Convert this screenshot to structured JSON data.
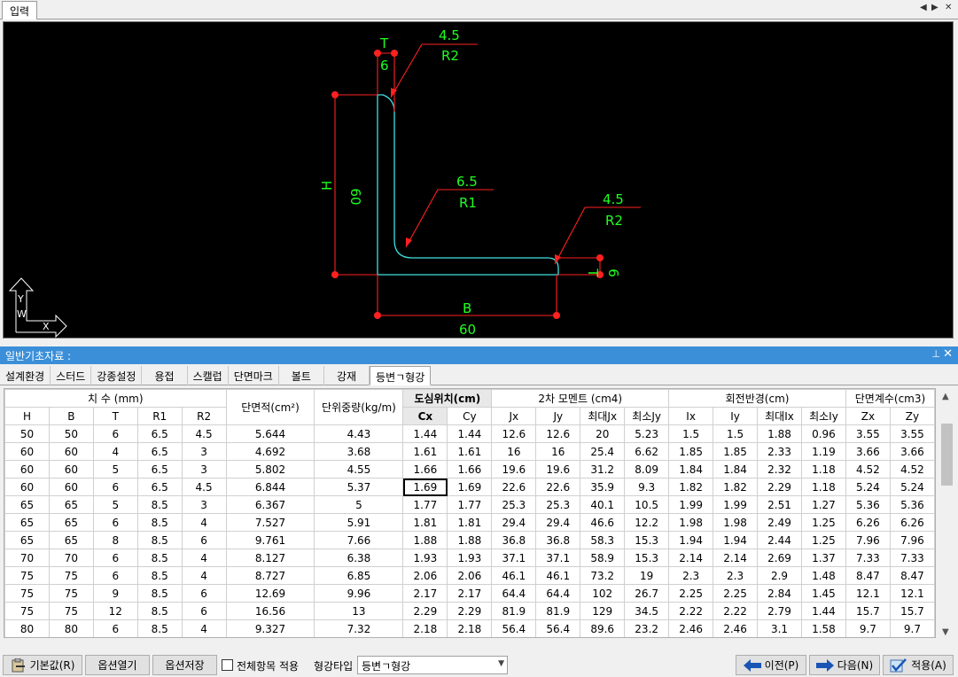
{
  "top_tab": {
    "label": "입력"
  },
  "strip": {
    "prev": "◀",
    "next": "▶",
    "close": "✕"
  },
  "drawing": {
    "t_top_label": "T",
    "t_top_value": "6",
    "r2_top_value": "4.5",
    "r2_top_label": "R2",
    "h_label": "H",
    "h_value": "60",
    "r1_value": "6.5",
    "r1_label": "R1",
    "r2_right_value": "4.5",
    "r2_right_label": "R2",
    "t_right_label": "T",
    "t_right_value": "6",
    "b_label": "B",
    "b_value": "60",
    "axis_y": "Y",
    "axis_w": "W",
    "axis_x": "X"
  },
  "panel": {
    "title": "일반기초자료 :",
    "pin": "⊥",
    "close": "✕"
  },
  "subtabs": [
    "설계환경",
    "스터드",
    "강종설정",
    "용접",
    "스캘럽",
    "단면마크",
    "볼트",
    "강재",
    "등변ㄱ형강"
  ],
  "table": {
    "group_headers": {
      "dims": "치 수 (mm)",
      "area": "단면적(cm²)",
      "weight": "단위중량(kg/m)",
      "centroid": "도심위치(cm)",
      "moment": "2차 모멘트 (cm4)",
      "radius": "회전반경(cm)",
      "modulus": "단면계수(cm3)"
    },
    "sub_headers": [
      "H",
      "B",
      "T",
      "R1",
      "R2",
      "Cx",
      "Cy",
      "Jx",
      "Jy",
      "최대Jx",
      "최소Jy",
      "Ix",
      "Iy",
      "최대Ix",
      "최소Iy",
      "Zx",
      "Zy"
    ],
    "rows": [
      [
        "50",
        "50",
        "6",
        "6.5",
        "4.5",
        "5.644",
        "4.43",
        "1.44",
        "1.44",
        "12.6",
        "12.6",
        "20",
        "5.23",
        "1.5",
        "1.5",
        "1.88",
        "0.96",
        "3.55",
        "3.55"
      ],
      [
        "60",
        "60",
        "4",
        "6.5",
        "3",
        "4.692",
        "3.68",
        "1.61",
        "1.61",
        "16",
        "16",
        "25.4",
        "6.62",
        "1.85",
        "1.85",
        "2.33",
        "1.19",
        "3.66",
        "3.66"
      ],
      [
        "60",
        "60",
        "5",
        "6.5",
        "3",
        "5.802",
        "4.55",
        "1.66",
        "1.66",
        "19.6",
        "19.6",
        "31.2",
        "8.09",
        "1.84",
        "1.84",
        "2.32",
        "1.18",
        "4.52",
        "4.52"
      ],
      [
        "60",
        "60",
        "6",
        "6.5",
        "4.5",
        "6.844",
        "5.37",
        "1.69",
        "1.69",
        "22.6",
        "22.6",
        "35.9",
        "9.3",
        "1.82",
        "1.82",
        "2.29",
        "1.18",
        "5.24",
        "5.24"
      ],
      [
        "65",
        "65",
        "5",
        "8.5",
        "3",
        "6.367",
        "5",
        "1.77",
        "1.77",
        "25.3",
        "25.3",
        "40.1",
        "10.5",
        "1.99",
        "1.99",
        "2.51",
        "1.27",
        "5.36",
        "5.36"
      ],
      [
        "65",
        "65",
        "6",
        "8.5",
        "4",
        "7.527",
        "5.91",
        "1.81",
        "1.81",
        "29.4",
        "29.4",
        "46.6",
        "12.2",
        "1.98",
        "1.98",
        "2.49",
        "1.25",
        "6.26",
        "6.26"
      ],
      [
        "65",
        "65",
        "8",
        "8.5",
        "6",
        "9.761",
        "7.66",
        "1.88",
        "1.88",
        "36.8",
        "36.8",
        "58.3",
        "15.3",
        "1.94",
        "1.94",
        "2.44",
        "1.25",
        "7.96",
        "7.96"
      ],
      [
        "70",
        "70",
        "6",
        "8.5",
        "4",
        "8.127",
        "6.38",
        "1.93",
        "1.93",
        "37.1",
        "37.1",
        "58.9",
        "15.3",
        "2.14",
        "2.14",
        "2.69",
        "1.37",
        "7.33",
        "7.33"
      ],
      [
        "75",
        "75",
        "6",
        "8.5",
        "4",
        "8.727",
        "6.85",
        "2.06",
        "2.06",
        "46.1",
        "46.1",
        "73.2",
        "19",
        "2.3",
        "2.3",
        "2.9",
        "1.48",
        "8.47",
        "8.47"
      ],
      [
        "75",
        "75",
        "9",
        "8.5",
        "6",
        "12.69",
        "9.96",
        "2.17",
        "2.17",
        "64.4",
        "64.4",
        "102",
        "26.7",
        "2.25",
        "2.25",
        "2.84",
        "1.45",
        "12.1",
        "12.1"
      ],
      [
        "75",
        "75",
        "12",
        "8.5",
        "6",
        "16.56",
        "13",
        "2.29",
        "2.29",
        "81.9",
        "81.9",
        "129",
        "34.5",
        "2.22",
        "2.22",
        "2.79",
        "1.44",
        "15.7",
        "15.7"
      ],
      [
        "80",
        "80",
        "6",
        "8.5",
        "4",
        "9.327",
        "7.32",
        "2.18",
        "2.18",
        "56.4",
        "56.4",
        "89.6",
        "23.2",
        "2.46",
        "2.46",
        "3.1",
        "1.58",
        "9.7",
        "9.7"
      ]
    ]
  },
  "bottom": {
    "default_button": "기본값(R)",
    "open_options": "옵션열기",
    "save_options": "옵션저장",
    "apply_all": "전체항목 적용",
    "steel_type_label": "형강타입",
    "steel_type_value": "등변ㄱ형강",
    "prev_button": "이전(P)",
    "next_button": "다음(N)",
    "apply_button": "적용(A)"
  }
}
